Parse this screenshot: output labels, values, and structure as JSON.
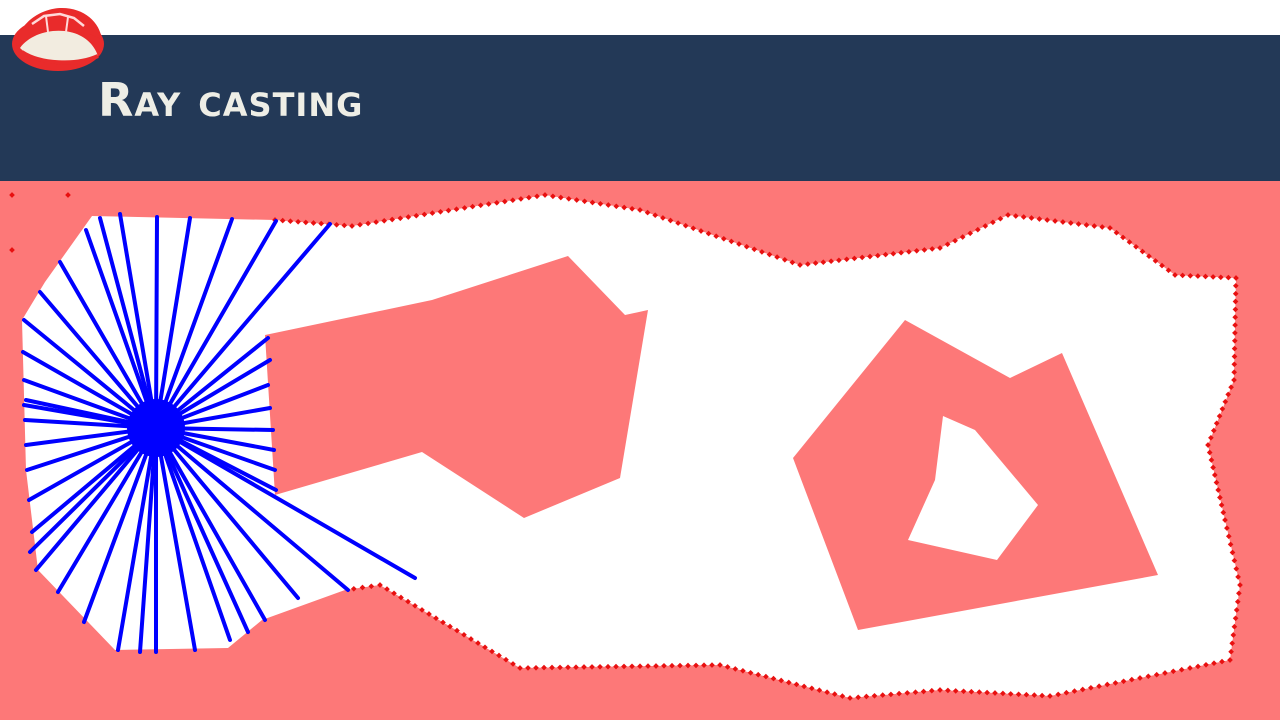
{
  "slide": {
    "title": "Ray casting"
  },
  "logo": {
    "icon": "turtle-shell-icon"
  },
  "colors": {
    "header": "#233957",
    "title_text": "#eeeee6",
    "obstacle_fill": "#fd7878",
    "free_space": "#ffffff",
    "ray": "#0000ff",
    "boundary_points": "#e81010",
    "logo_red": "#e92b2b",
    "logo_cream": "#f2ece0"
  },
  "visualization": {
    "rays": {
      "count": 42
    }
  }
}
